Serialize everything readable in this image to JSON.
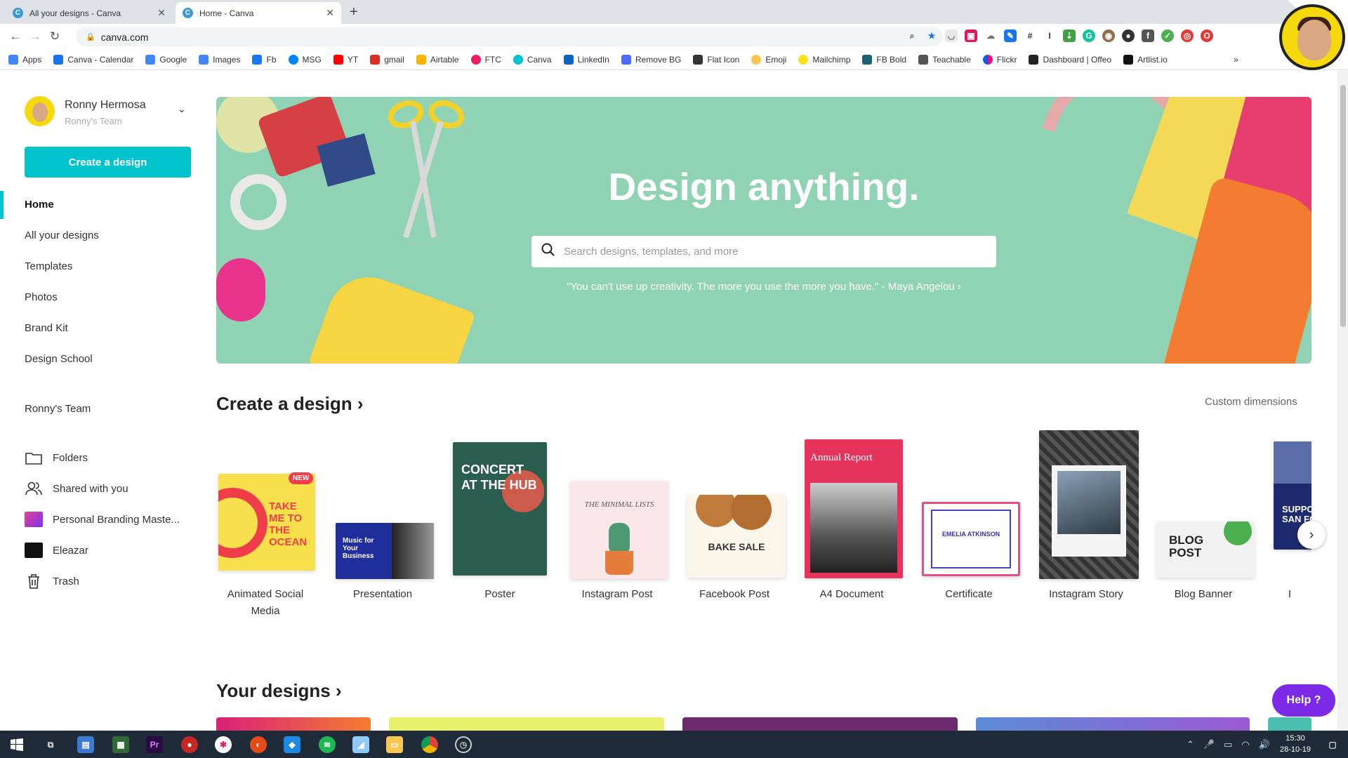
{
  "browser": {
    "tabs": [
      {
        "title": "All your designs - Canva",
        "active": false
      },
      {
        "title": "Home - Canva",
        "active": true
      }
    ],
    "new_tab": "+",
    "url": "canva.com",
    "bookmarks": [
      {
        "label": "Apps",
        "color": "#4285f4"
      },
      {
        "label": "Canva - Calendar",
        "color": "#1a73e8"
      },
      {
        "label": "Google",
        "color": "#4285f4"
      },
      {
        "label": "Images",
        "color": "#4285f4"
      },
      {
        "label": "Fb",
        "color": "#1877f2"
      },
      {
        "label": "MSG",
        "color": "#0084ff"
      },
      {
        "label": "YT",
        "color": "#ff0000"
      },
      {
        "label": "gmail",
        "color": "#d93025"
      },
      {
        "label": "Airtable",
        "color": "#fcb400"
      },
      {
        "label": "FTC",
        "color": "#e91e63"
      },
      {
        "label": "Canva",
        "color": "#00c4cc"
      },
      {
        "label": "LinkedIn",
        "color": "#0a66c2"
      },
      {
        "label": "Remove BG",
        "color": "#4a6cf7"
      },
      {
        "label": "Flat Icon",
        "color": "#333333"
      },
      {
        "label": "Emoji",
        "color": "#f9c74f"
      },
      {
        "label": "Mailchimp",
        "color": "#ffe01b"
      },
      {
        "label": "FB Bold",
        "color": "#1e5f74"
      },
      {
        "label": "Teachable",
        "color": "#555555"
      },
      {
        "label": "Flickr",
        "color": "#ff0084"
      },
      {
        "label": "Dashboard | Offeo",
        "color": "#222222"
      },
      {
        "label": "Artlist.io",
        "color": "#111111"
      }
    ],
    "bookmarks_more": "»"
  },
  "sidebar": {
    "user_name": "Ronny Hermosa",
    "user_team": "Ronny's Team",
    "create_button": "Create a design",
    "nav": [
      "Home",
      "All your designs",
      "Templates",
      "Photos",
      "Brand Kit",
      "Design School"
    ],
    "team_label": "Ronny's Team",
    "items": [
      {
        "label": "Folders",
        "icon": "folder-icon"
      },
      {
        "label": "Shared with you",
        "icon": "people-icon"
      },
      {
        "label": "Personal Branding Maste...",
        "icon": "folder-thumbnail-icon"
      },
      {
        "label": "Eleazar",
        "icon": "folder-thumbnail-icon"
      },
      {
        "label": "Trash",
        "icon": "trash-icon"
      }
    ]
  },
  "hero": {
    "title": "Design anything.",
    "search_placeholder": "Search designs, templates, and more",
    "quote": "\"You can't use up creativity. The more you use the more you have.\" - Maya Angelou ›"
  },
  "create_section": {
    "heading": "Create a design ›",
    "custom_dimensions": "Custom dimensions",
    "cards": [
      {
        "label": "Animated Social Media",
        "badge": "NEW",
        "thumb_text": "TAKE ME TO THE OCEAN"
      },
      {
        "label": "Presentation",
        "thumb_text": "Music for Your Business"
      },
      {
        "label": "Poster",
        "thumb_text": "CONCERT AT THE HUB"
      },
      {
        "label": "Instagram Post",
        "thumb_text": "THE MINIMAL LISTS"
      },
      {
        "label": "Facebook Post",
        "thumb_text": "BAKE SALE"
      },
      {
        "label": "A4 Document",
        "thumb_text": "Annual Report"
      },
      {
        "label": "Certificate",
        "thumb_text": "EMELIA ATKINSON"
      },
      {
        "label": "Instagram Story",
        "thumb_text": ""
      },
      {
        "label": "Blog Banner",
        "thumb_text": "BLOG POST"
      },
      {
        "label": "I",
        "thumb_text": "SUPPO SAN FO"
      }
    ],
    "next_arrow": "›"
  },
  "your_designs": {
    "heading": "Your designs ›"
  },
  "help": {
    "label": "Help ?"
  },
  "taskbar": {
    "time": "15:30",
    "date": "28-10-19"
  },
  "colors": {
    "brand": "#00c4cc",
    "help": "#7d2ae8",
    "hero": "#8fd3b4"
  }
}
